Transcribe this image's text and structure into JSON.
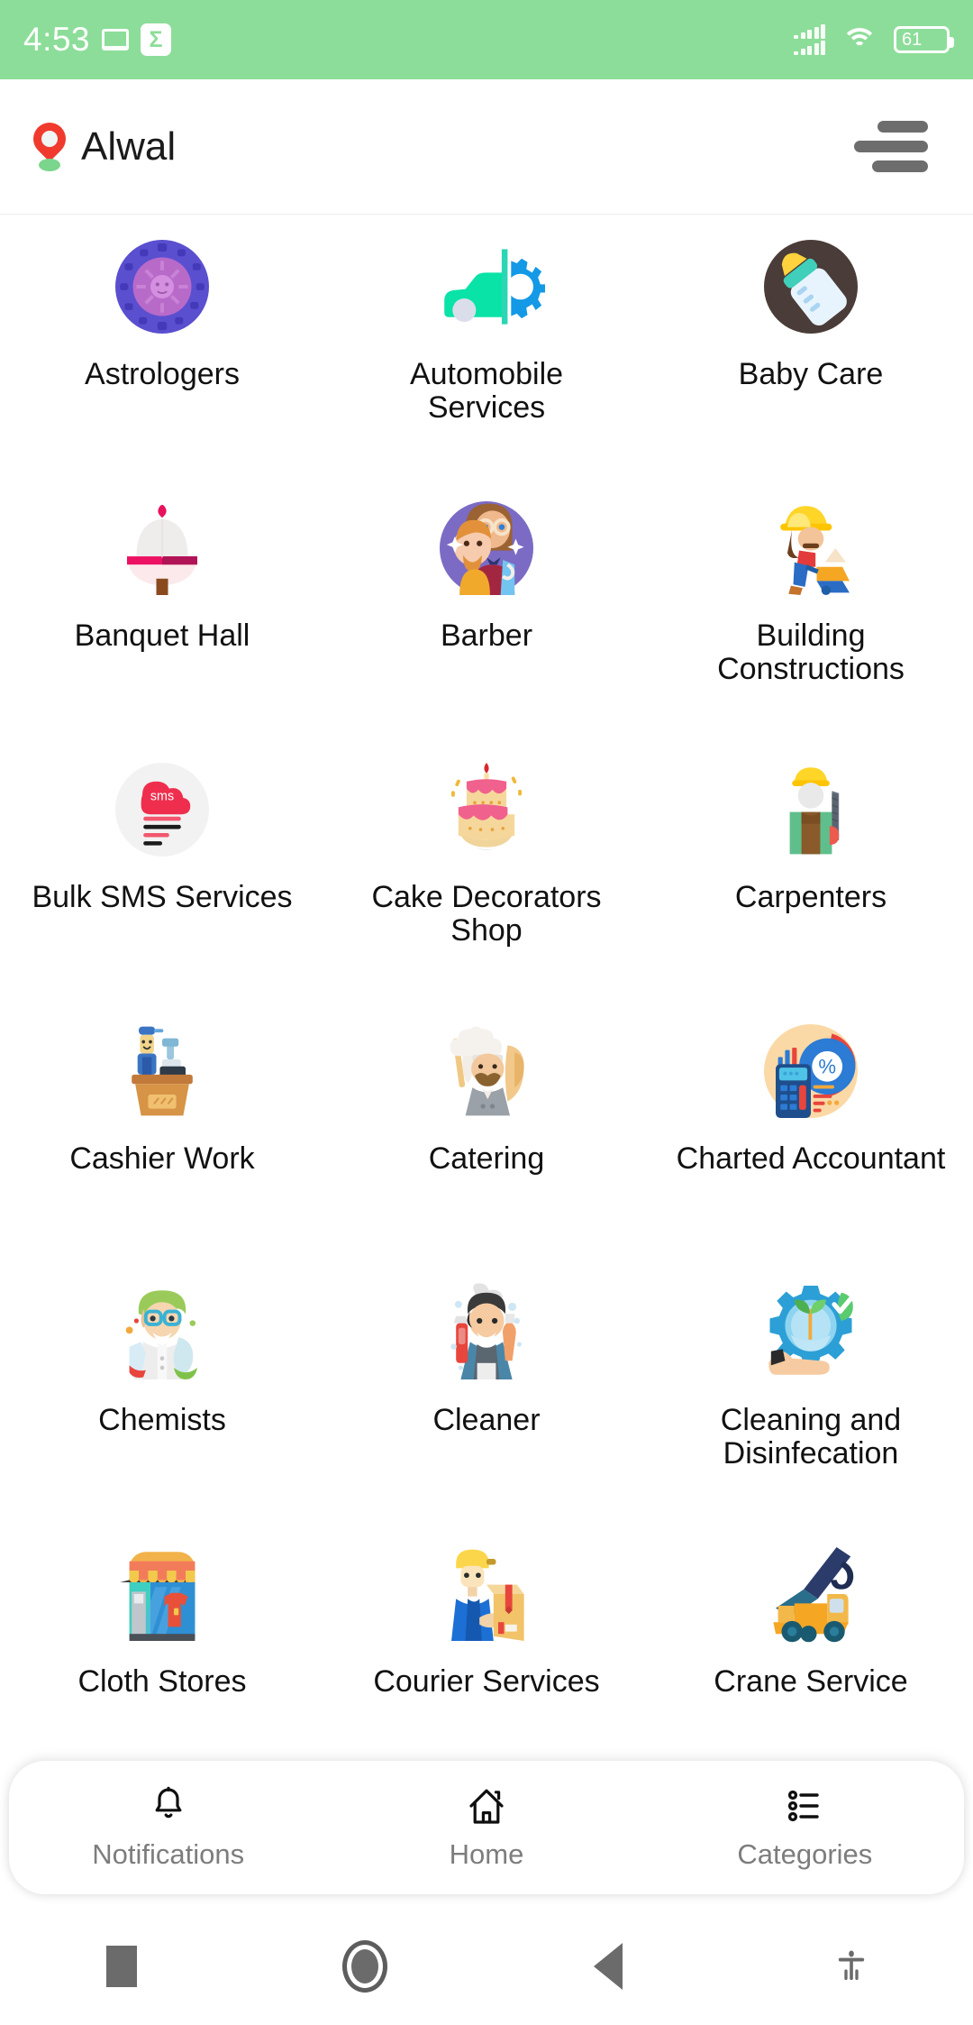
{
  "status_bar": {
    "time": "4:53",
    "cast_icon": "cast-screen-icon",
    "app_badge_icon": "sigma-badge-icon",
    "app_badge_glyph": "Σ",
    "signal_icon": "dual-signal-bars-icon",
    "wifi_icon": "wifi-icon",
    "battery_icon": "battery-icon",
    "battery_level": "61",
    "background_color": "#8CDD99"
  },
  "header": {
    "location_pin_icon": "location-pin-icon",
    "location": "Alwal",
    "menu_icon": "hamburger-menu-icon"
  },
  "categories": [
    {
      "label": "Astrologers",
      "icon": "astrology-wheel-icon"
    },
    {
      "label": "Automobile Services",
      "icon": "car-gear-icon"
    },
    {
      "label": "Baby Care",
      "icon": "baby-bottle-icon"
    },
    {
      "label": "Banquet Hall",
      "icon": "banquet-canopy-icon"
    },
    {
      "label": "Barber",
      "icon": "barber-people-icon"
    },
    {
      "label": "Building Constructions",
      "icon": "construction-worker-icon"
    },
    {
      "label": "Bulk SMS Services",
      "icon": "sms-cloud-icon"
    },
    {
      "label": "Cake Decorators Shop",
      "icon": "tiered-cake-icon"
    },
    {
      "label": "Carpenters",
      "icon": "carpenter-saw-icon"
    },
    {
      "label": "Cashier Work",
      "icon": "cashier-counter-icon"
    },
    {
      "label": "Catering",
      "icon": "chef-icon"
    },
    {
      "label": "Charted Accountant",
      "icon": "calculator-piechart-icon"
    },
    {
      "label": "Chemists",
      "icon": "chemist-scientist-icon"
    },
    {
      "label": "Cleaner",
      "icon": "cleaner-spray-icon"
    },
    {
      "label": "Cleaning and Disinfecation",
      "icon": "eco-gear-hand-icon"
    },
    {
      "label": "Cloth Stores",
      "icon": "clothing-shop-icon"
    },
    {
      "label": "Courier Services",
      "icon": "courier-parcel-icon"
    },
    {
      "label": "Crane Service",
      "icon": "crane-truck-icon"
    }
  ],
  "bottom_nav": [
    {
      "label": "Notifications",
      "icon": "bell-icon"
    },
    {
      "label": "Home",
      "icon": "home-icon"
    },
    {
      "label": "Categories",
      "icon": "list-icon"
    }
  ],
  "system_nav": [
    {
      "name": "recents-button"
    },
    {
      "name": "home-button"
    },
    {
      "name": "back-button"
    },
    {
      "name": "accessibility-button"
    }
  ]
}
